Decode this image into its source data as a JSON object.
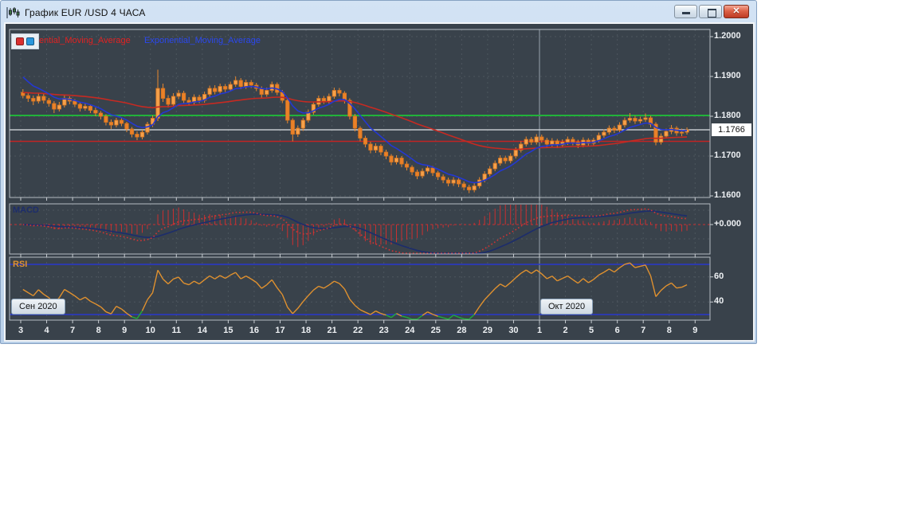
{
  "window": {
    "title": "График EUR /USD  4 ЧАСА",
    "icons": {
      "app": "candlestick-chart-icon",
      "minimize": "—",
      "maximize": "▢",
      "close": "✕"
    }
  },
  "legend": {
    "red_series_label": "ential_Moving_Average",
    "blue_series_label": "Exponential_Moving_Average"
  },
  "panels": {
    "macd": {
      "label": "MACD",
      "axis_ticks": [
        {
          "label": "+0.000",
          "value": 0
        }
      ]
    },
    "rsi": {
      "label": "RSI",
      "axis_ticks": [
        {
          "label": "60",
          "value": 60
        },
        {
          "label": "40",
          "value": 40
        }
      ],
      "level_lines": [
        70,
        30
      ]
    }
  },
  "price_axis": {
    "ticks": [
      {
        "label": "1.2000",
        "value": 1.2
      },
      {
        "label": "1.1900",
        "value": 1.19
      },
      {
        "label": "1.1800",
        "value": 1.18
      },
      {
        "label": "1.1700",
        "value": 1.17
      },
      {
        "label": "1.1600",
        "value": 1.16
      }
    ],
    "current_label": "1.1766",
    "current_value": 1.1766
  },
  "x_axis": {
    "labels": [
      "3",
      "4",
      "7",
      "8",
      "9",
      "10",
      "11",
      "14",
      "15",
      "16",
      "17",
      "18",
      "21",
      "22",
      "23",
      "24",
      "25",
      "28",
      "29",
      "30",
      "1",
      "2",
      "5",
      "6",
      "7",
      "8",
      "9"
    ]
  },
  "months": [
    {
      "label": "Сен 2020",
      "day_index": 0
    },
    {
      "label": "Окт 2020",
      "day_index": 20
    }
  ],
  "colors": {
    "chart_bg": "#39424b",
    "frame": "#b5bcc3",
    "grid": "#4d565e",
    "axis_text": "#eef1f4",
    "candle_stroke": "#d9751f",
    "candle_wick": "#e8892f",
    "candle_up": "#f5a14b",
    "candle_down": "#ea8128",
    "ema_fast_blue": "#2438d2",
    "ema_slow_red": "#c62a22",
    "green_hline": "#21b23a",
    "red_hline": "#c22424",
    "current_price_line": "#dde2e6",
    "macd_zero_red": "#cc3030",
    "macd_dotted_red": "#d23434",
    "macd_signal_navy": "#1d2d6b",
    "rsi_orange": "#e0912f",
    "rsi_oversold_green": "#1fae3a",
    "rsi_levels_blue": "#2838cc",
    "month_line": "#98a2ac",
    "tick": "#c8cdd2"
  },
  "chart_data": {
    "type": "candlestick",
    "title": "EUR/USD 4-hour chart with EMA overlays, MACD and RSI panels",
    "x_labels": [
      "3",
      "4",
      "7",
      "8",
      "9",
      "10",
      "11",
      "14",
      "15",
      "16",
      "17",
      "18",
      "21",
      "22",
      "23",
      "24",
      "25",
      "28",
      "29",
      "30",
      "1",
      "2",
      "5",
      "6",
      "7",
      "8"
    ],
    "candles_per_day": 5,
    "ylim": [
      1.1596,
      1.2018
    ],
    "hlines": [
      {
        "value": 1.1802,
        "color": "#21b23a",
        "name": "green-level-line"
      },
      {
        "value": 1.1766,
        "color": "#dde2e6",
        "name": "current-price-line"
      },
      {
        "value": 1.1737,
        "color": "#c22424",
        "name": "red-level-line"
      }
    ],
    "ohlc": [
      [
        1.186,
        1.1868,
        1.1845,
        1.1852
      ],
      [
        1.1852,
        1.186,
        1.1836,
        1.1845
      ],
      [
        1.1845,
        1.1852,
        1.1828,
        1.1838
      ],
      [
        1.1838,
        1.1858,
        1.1832,
        1.185
      ],
      [
        1.185,
        1.1856,
        1.1832,
        1.184
      ],
      [
        1.184,
        1.1846,
        1.1824,
        1.1832
      ],
      [
        1.1832,
        1.1838,
        1.1808,
        1.1818
      ],
      [
        1.1818,
        1.1836,
        1.1812,
        1.1828
      ],
      [
        1.1828,
        1.1852,
        1.1822,
        1.1845
      ],
      [
        1.1845,
        1.185,
        1.183,
        1.1838
      ],
      [
        1.1838,
        1.1843,
        1.1823,
        1.183
      ],
      [
        1.183,
        1.1836,
        1.1812,
        1.182
      ],
      [
        1.182,
        1.1832,
        1.1814,
        1.1825
      ],
      [
        1.1825,
        1.183,
        1.1808,
        1.1815
      ],
      [
        1.1815,
        1.1822,
        1.18,
        1.1808
      ],
      [
        1.1808,
        1.1813,
        1.1792,
        1.18
      ],
      [
        1.18,
        1.1805,
        1.1777,
        1.1785
      ],
      [
        1.1785,
        1.1792,
        1.1768,
        1.1778
      ],
      [
        1.1778,
        1.1796,
        1.1772,
        1.179
      ],
      [
        1.179,
        1.1796,
        1.1775,
        1.1782
      ],
      [
        1.1782,
        1.1786,
        1.176,
        1.1768
      ],
      [
        1.1768,
        1.1773,
        1.1747,
        1.1755
      ],
      [
        1.1755,
        1.1762,
        1.174,
        1.1748
      ],
      [
        1.1748,
        1.1766,
        1.1742,
        1.176
      ],
      [
        1.176,
        1.1786,
        1.1754,
        1.178
      ],
      [
        1.178,
        1.1802,
        1.1773,
        1.1795
      ],
      [
        1.1795,
        1.1917,
        1.1788,
        1.187
      ],
      [
        1.187,
        1.1882,
        1.1836,
        1.1845
      ],
      [
        1.1845,
        1.1853,
        1.1822,
        1.183
      ],
      [
        1.183,
        1.1858,
        1.1824,
        1.185
      ],
      [
        1.185,
        1.1866,
        1.1843,
        1.1858
      ],
      [
        1.1858,
        1.1864,
        1.1832,
        1.184
      ],
      [
        1.184,
        1.1848,
        1.1827,
        1.1835
      ],
      [
        1.1835,
        1.1855,
        1.1829,
        1.1848
      ],
      [
        1.1848,
        1.1854,
        1.1833,
        1.184
      ],
      [
        1.184,
        1.1862,
        1.1834,
        1.1855
      ],
      [
        1.1855,
        1.1877,
        1.1848,
        1.187
      ],
      [
        1.187,
        1.1878,
        1.1855,
        1.1862
      ],
      [
        1.1862,
        1.1882,
        1.1856,
        1.1875
      ],
      [
        1.1875,
        1.1881,
        1.1861,
        1.1868
      ],
      [
        1.1868,
        1.1887,
        1.1862,
        1.188
      ],
      [
        1.188,
        1.19,
        1.1874,
        1.189
      ],
      [
        1.189,
        1.1896,
        1.1868,
        1.1875
      ],
      [
        1.1875,
        1.1892,
        1.1869,
        1.1885
      ],
      [
        1.1885,
        1.1891,
        1.1871,
        1.1878
      ],
      [
        1.1878,
        1.1884,
        1.1863,
        1.187
      ],
      [
        1.187,
        1.1875,
        1.1847,
        1.1855
      ],
      [
        1.1855,
        1.1872,
        1.1849,
        1.1865
      ],
      [
        1.1865,
        1.1887,
        1.1859,
        1.188
      ],
      [
        1.188,
        1.1885,
        1.1853,
        1.186
      ],
      [
        1.186,
        1.1866,
        1.1833,
        1.184
      ],
      [
        1.184,
        1.1845,
        1.1782,
        1.179
      ],
      [
        1.179,
        1.1795,
        1.1737,
        1.1755
      ],
      [
        1.1755,
        1.1777,
        1.1748,
        1.177
      ],
      [
        1.177,
        1.1796,
        1.1763,
        1.179
      ],
      [
        1.179,
        1.1817,
        1.1784,
        1.181
      ],
      [
        1.181,
        1.1837,
        1.1804,
        1.183
      ],
      [
        1.183,
        1.1852,
        1.1824,
        1.1845
      ],
      [
        1.1845,
        1.1851,
        1.1831,
        1.1838
      ],
      [
        1.1838,
        1.1857,
        1.1832,
        1.185
      ],
      [
        1.185,
        1.1872,
        1.1844,
        1.1865
      ],
      [
        1.1865,
        1.1871,
        1.185,
        1.1858
      ],
      [
        1.1858,
        1.1863,
        1.1832,
        1.184
      ],
      [
        1.184,
        1.1845,
        1.1792,
        1.18
      ],
      [
        1.18,
        1.1806,
        1.1762,
        1.177
      ],
      [
        1.177,
        1.1775,
        1.1737,
        1.1745
      ],
      [
        1.1745,
        1.1751,
        1.1722,
        1.173
      ],
      [
        1.173,
        1.1736,
        1.1707,
        1.1715
      ],
      [
        1.1715,
        1.1732,
        1.1708,
        1.1725
      ],
      [
        1.1725,
        1.173,
        1.1702,
        1.171
      ],
      [
        1.171,
        1.1716,
        1.1692,
        1.17
      ],
      [
        1.17,
        1.1705,
        1.1677,
        1.1685
      ],
      [
        1.1685,
        1.1702,
        1.1679,
        1.1695
      ],
      [
        1.1695,
        1.17,
        1.1672,
        1.168
      ],
      [
        1.168,
        1.1687,
        1.1664,
        1.1672
      ],
      [
        1.1672,
        1.1677,
        1.1652,
        1.166
      ],
      [
        1.166,
        1.1666,
        1.1642,
        1.165
      ],
      [
        1.165,
        1.1669,
        1.1644,
        1.1662
      ],
      [
        1.1662,
        1.1677,
        1.1655,
        1.167
      ],
      [
        1.167,
        1.1675,
        1.165,
        1.1658
      ],
      [
        1.1658,
        1.1663,
        1.164,
        1.1648
      ],
      [
        1.1648,
        1.1654,
        1.1632,
        1.164
      ],
      [
        1.164,
        1.1646,
        1.1624,
        1.1632
      ],
      [
        1.1632,
        1.1647,
        1.1625,
        1.164
      ],
      [
        1.164,
        1.1645,
        1.1622,
        1.163
      ],
      [
        1.163,
        1.1636,
        1.1614,
        1.1622
      ],
      [
        1.1622,
        1.1628,
        1.1607,
        1.1615
      ],
      [
        1.1615,
        1.1632,
        1.1609,
        1.1625
      ],
      [
        1.1625,
        1.1647,
        1.1619,
        1.164
      ],
      [
        1.164,
        1.1662,
        1.1634,
        1.1655
      ],
      [
        1.1655,
        1.1675,
        1.1649,
        1.1668
      ],
      [
        1.1668,
        1.1689,
        1.1662,
        1.1682
      ],
      [
        1.1682,
        1.1702,
        1.1676,
        1.1695
      ],
      [
        1.1695,
        1.1701,
        1.1681,
        1.1688
      ],
      [
        1.1688,
        1.1707,
        1.1682,
        1.17
      ],
      [
        1.17,
        1.1722,
        1.1694,
        1.1715
      ],
      [
        1.1715,
        1.1737,
        1.1709,
        1.173
      ],
      [
        1.173,
        1.1749,
        1.1724,
        1.1742
      ],
      [
        1.1742,
        1.1748,
        1.1728,
        1.1735
      ],
      [
        1.1735,
        1.1755,
        1.1729,
        1.1748
      ],
      [
        1.1748,
        1.1754,
        1.1733,
        1.174
      ],
      [
        1.174,
        1.1746,
        1.1722,
        1.173
      ],
      [
        1.173,
        1.1745,
        1.1724,
        1.1738
      ],
      [
        1.1738,
        1.1743,
        1.172,
        1.1728
      ],
      [
        1.1728,
        1.1742,
        1.1721,
        1.1735
      ],
      [
        1.1735,
        1.1749,
        1.1728,
        1.1742
      ],
      [
        1.1742,
        1.1748,
        1.1727,
        1.1735
      ],
      [
        1.1735,
        1.1741,
        1.172,
        1.1728
      ],
      [
        1.1728,
        1.1747,
        1.1722,
        1.174
      ],
      [
        1.174,
        1.1745,
        1.1725,
        1.1732
      ],
      [
        1.1732,
        1.1746,
        1.1726,
        1.174
      ],
      [
        1.174,
        1.1759,
        1.1734,
        1.1752
      ],
      [
        1.1752,
        1.1767,
        1.1746,
        1.176
      ],
      [
        1.176,
        1.1777,
        1.1754,
        1.177
      ],
      [
        1.177,
        1.1776,
        1.1758,
        1.1765
      ],
      [
        1.1765,
        1.1785,
        1.1759,
        1.1778
      ],
      [
        1.1778,
        1.1797,
        1.1772,
        1.179
      ],
      [
        1.179,
        1.1808,
        1.1784,
        1.1795
      ],
      [
        1.1795,
        1.1801,
        1.1781,
        1.1788
      ],
      [
        1.1788,
        1.1799,
        1.1782,
        1.1792
      ],
      [
        1.1792,
        1.1807,
        1.1786,
        1.1796
      ],
      [
        1.1796,
        1.1801,
        1.1772,
        1.178
      ],
      [
        1.178,
        1.1785,
        1.1727,
        1.1735
      ],
      [
        1.1735,
        1.1757,
        1.1729,
        1.175
      ],
      [
        1.175,
        1.1769,
        1.1744,
        1.1762
      ],
      [
        1.1762,
        1.1778,
        1.1755,
        1.177
      ],
      [
        1.177,
        1.1775,
        1.1751,
        1.1758
      ],
      [
        1.1758,
        1.1769,
        1.175,
        1.176
      ],
      [
        1.176,
        1.1772,
        1.1754,
        1.1766
      ]
    ]
  }
}
